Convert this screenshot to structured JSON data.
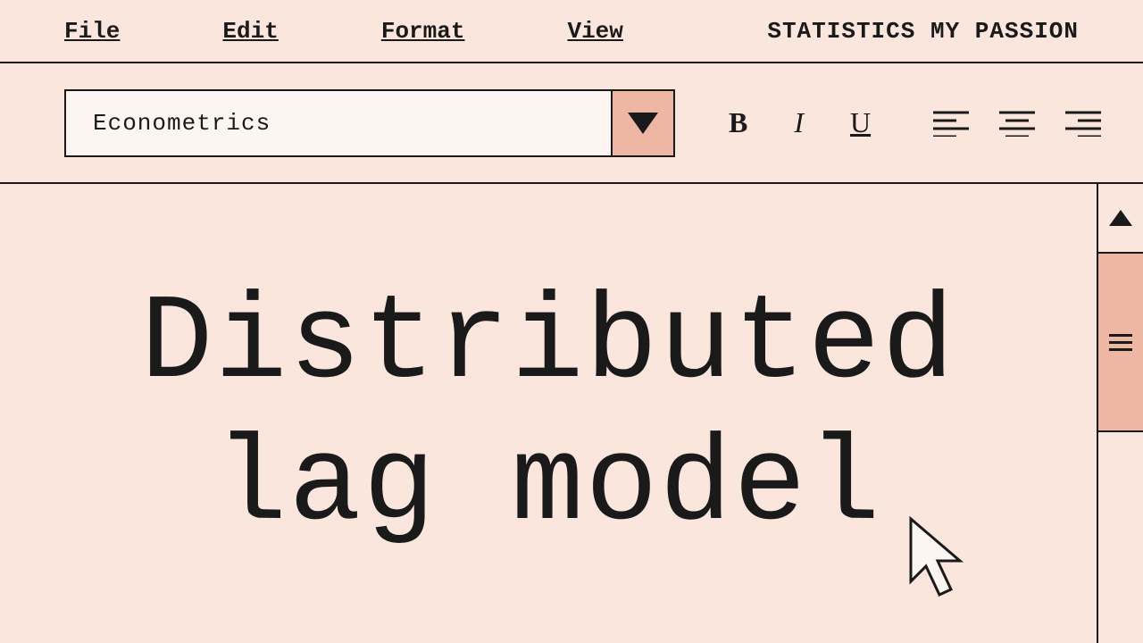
{
  "menubar": {
    "items": [
      "File",
      "Edit",
      "Format",
      "View"
    ],
    "app_title": "STATISTICS MY PASSION"
  },
  "toolbar": {
    "select_value": "Econometrics",
    "bold_label": "B",
    "italic_label": "I",
    "underline_label": "U"
  },
  "document": {
    "heading_line1": "Distributed",
    "heading_line2": "lag model"
  }
}
